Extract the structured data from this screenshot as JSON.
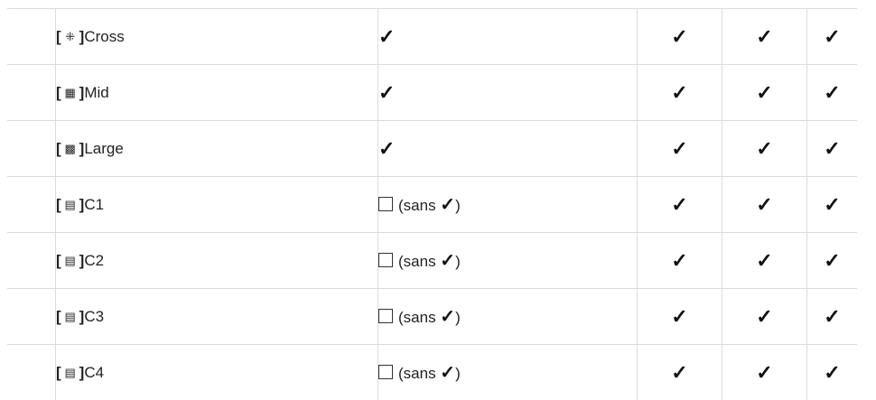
{
  "rows": [
    {
      "bracket_open": "[",
      "icon_glyph": "⁜",
      "icon_name": "cross-af-target-icon",
      "bracket_close": "]",
      "label": "Cross",
      "col2": {
        "type": "check",
        "check": "✓"
      },
      "cols": [
        "✓",
        "✓",
        "✓"
      ]
    },
    {
      "bracket_open": "[",
      "icon_glyph": "▦",
      "icon_name": "mid-af-target-icon",
      "bracket_close": "]",
      "label": "Mid",
      "col2": {
        "type": "check",
        "check": "✓"
      },
      "cols": [
        "✓",
        "✓",
        "✓"
      ]
    },
    {
      "bracket_open": "[",
      "icon_glyph": "▩",
      "icon_name": "large-af-target-icon",
      "bracket_close": "]",
      "label": "Large",
      "col2": {
        "type": "check",
        "check": "✓"
      },
      "cols": [
        "✓",
        "✓",
        "✓"
      ]
    },
    {
      "bracket_open": "[",
      "icon_glyph": "▤",
      "icon_name": "custom-af-target-icon",
      "bracket_close": "]",
      "label": "C1",
      "col2": {
        "type": "box",
        "prefix": "(sans ",
        "check": "✓",
        "suffix": ")"
      },
      "cols": [
        "✓",
        "✓",
        "✓"
      ]
    },
    {
      "bracket_open": "[",
      "icon_glyph": "▤",
      "icon_name": "custom-af-target-icon",
      "bracket_close": "]",
      "label": "C2",
      "col2": {
        "type": "box",
        "prefix": "(sans ",
        "check": "✓",
        "suffix": ")"
      },
      "cols": [
        "✓",
        "✓",
        "✓"
      ]
    },
    {
      "bracket_open": "[",
      "icon_glyph": "▤",
      "icon_name": "custom-af-target-icon",
      "bracket_close": "]",
      "label": "C3",
      "col2": {
        "type": "box",
        "prefix": "(sans ",
        "check": "✓",
        "suffix": ")"
      },
      "cols": [
        "✓",
        "✓",
        "✓"
      ]
    },
    {
      "bracket_open": "[",
      "icon_glyph": "▤",
      "icon_name": "custom-af-target-icon",
      "bracket_close": "]",
      "label": "C4",
      "col2": {
        "type": "box",
        "prefix": "(sans ",
        "check": "✓",
        "suffix": ")"
      },
      "cols": [
        "✓",
        "✓",
        "✓"
      ]
    }
  ],
  "colors": {
    "border": "#dcdcdc",
    "text": "#222222",
    "check": "#111111"
  }
}
